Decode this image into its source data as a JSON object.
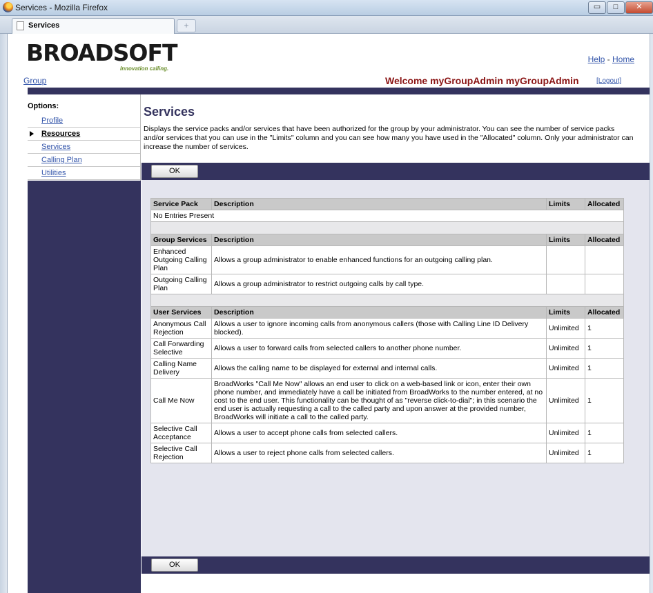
{
  "window": {
    "title": "Services - Mozilla Firefox",
    "tab_label": "Services",
    "new_tab_symbol": "+",
    "minimize_symbol": "▭",
    "maximize_symbol": "□",
    "close_symbol": "✕"
  },
  "header": {
    "logo": "BROADSOFT",
    "tagline": "Innovation calling.",
    "help_link": "Help",
    "separator": "-",
    "home_link": "Home",
    "group_link": "Group",
    "welcome": "Welcome myGroupAdmin myGroupAdmin",
    "logout": "[Logout]"
  },
  "sidebar": {
    "heading": "Options:",
    "items": [
      {
        "label": "Profile",
        "active": false
      },
      {
        "label": "Resources",
        "active": true
      },
      {
        "label": "Services",
        "active": false
      },
      {
        "label": "Calling Plan",
        "active": false
      },
      {
        "label": "Utilities",
        "active": false
      }
    ]
  },
  "main": {
    "title": "Services",
    "intro": "Displays the service packs and/or services that have been authorized for the group by your administrator. You can see the number of service packs and/or services that you can use in the \"Limits\" column and you can see how many you have used in the \"Allocated\" column. Only your administrator can increase the number of services.",
    "ok_label": "OK"
  },
  "tables": {
    "service_pack": {
      "headers": [
        "Service Pack",
        "Description",
        "Limits",
        "Allocated"
      ],
      "empty_message": "No Entries Present"
    },
    "group_services": {
      "headers": [
        "Group Services",
        "Description",
        "Limits",
        "Allocated"
      ],
      "rows": [
        {
          "name": "Enhanced Outgoing Calling Plan",
          "description": "Allows a group administrator to enable enhanced functions for an outgoing calling plan.",
          "limits": "",
          "allocated": ""
        },
        {
          "name": "Outgoing Calling Plan",
          "description": "Allows a group administrator to restrict outgoing calls by call type.",
          "limits": "",
          "allocated": ""
        }
      ]
    },
    "user_services": {
      "headers": [
        "User Services",
        "Description",
        "Limits",
        "Allocated"
      ],
      "rows": [
        {
          "name": "Anonymous Call Rejection",
          "description": "Allows a user to ignore incoming calls from anonymous callers (those with Calling Line ID Delivery blocked).",
          "limits": "Unlimited",
          "allocated": "1"
        },
        {
          "name": "Call Forwarding Selective",
          "description": "Allows a user to forward calls from selected callers to another phone number.",
          "limits": "Unlimited",
          "allocated": "1"
        },
        {
          "name": "Calling Name Delivery",
          "description": "Allows the calling name to be displayed for external and internal calls.",
          "limits": "Unlimited",
          "allocated": "1"
        },
        {
          "name": "Call Me Now",
          "description": "BroadWorks \"Call Me Now\" allows an end user to click on a web-based link or icon, enter their own phone number, and immediately have a call be initiated from BroadWorks to the number entered, at no cost to the end user. This functionality can be thought of as \"reverse click-to-dial\"; in this scenario the end user is actually requesting a call to the called party and upon answer at the provided number, BroadWorks will initiate a call to the called party.",
          "limits": "Unlimited",
          "allocated": "1"
        },
        {
          "name": "Selective Call Acceptance",
          "description": "Allows a user to accept phone calls from selected callers.",
          "limits": "Unlimited",
          "allocated": "1"
        },
        {
          "name": "Selective Call Rejection",
          "description": "Allows a user to reject phone calls from selected callers.",
          "limits": "Unlimited",
          "allocated": "1"
        }
      ]
    }
  },
  "colors": {
    "navy": "#34335e",
    "welcome": "#8a1414",
    "link": "#3355aa"
  }
}
